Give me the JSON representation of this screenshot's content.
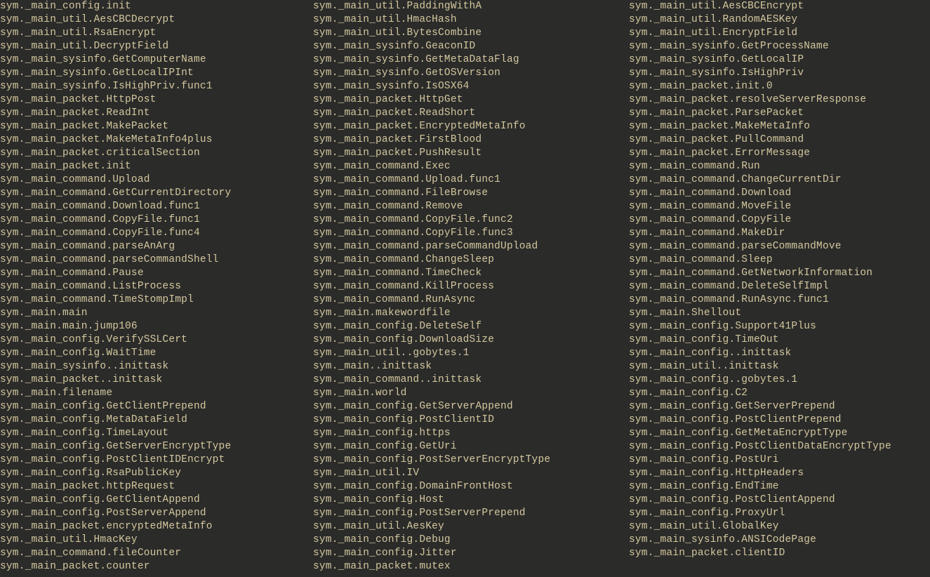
{
  "columns": [
    [
      "sym._main_config.init",
      "sym._main_util.AesCBCDecrypt",
      "sym._main_util.RsaEncrypt",
      "sym._main_util.DecryptField",
      "sym._main_sysinfo.GetComputerName",
      "sym._main_sysinfo.GetLocalIPInt",
      "sym._main_sysinfo.IsHighPriv.func1",
      "sym._main_packet.HttpPost",
      "sym._main_packet.ReadInt",
      "sym._main_packet.MakePacket",
      "sym._main_packet.MakeMetaInfo4plus",
      "sym._main_packet.criticalSection",
      "sym._main_packet.init",
      "sym._main_command.Upload",
      "sym._main_command.GetCurrentDirectory",
      "sym._main_command.Download.func1",
      "sym._main_command.CopyFile.func1",
      "sym._main_command.CopyFile.func4",
      "sym._main_command.parseAnArg",
      "sym._main_command.parseCommandShell",
      "sym._main_command.Pause",
      "sym._main_command.ListProcess",
      "sym._main_command.TimeStompImpl",
      "sym._main.main",
      "sym._main.main.jump106",
      "sym._main_config.VerifySSLCert",
      "sym._main_config.WaitTime",
      "sym._main_sysinfo..inittask",
      "sym._main_packet..inittask",
      "sym._main.filename",
      "sym._main_config.GetClientPrepend",
      "sym._main_config.MetaDataField",
      "sym._main_config.TimeLayout",
      "sym._main_config.GetServerEncryptType",
      "sym._main_config.PostClientIDEncrypt",
      "sym._main_config.RsaPublicKey",
      "sym._main_packet.httpRequest",
      "sym._main_config.GetClientAppend",
      "sym._main_config.PostServerAppend",
      "sym._main_packet.encryptedMetaInfo",
      "sym._main_util.HmacKey",
      "sym._main_command.fileCounter",
      "sym._main_packet.counter"
    ],
    [
      "sym._main_util.PaddingWithA",
      "sym._main_util.HmacHash",
      "sym._main_util.BytesCombine",
      "sym._main_sysinfo.GeaconID",
      "sym._main_sysinfo.GetMetaDataFlag",
      "sym._main_sysinfo.GetOSVersion",
      "sym._main_sysinfo.IsOSX64",
      "sym._main_packet.HttpGet",
      "sym._main_packet.ReadShort",
      "sym._main_packet.EncryptedMetaInfo",
      "sym._main_packet.FirstBlood",
      "sym._main_packet.PushResult",
      "sym._main_command.Exec",
      "sym._main_command.Upload.func1",
      "sym._main_command.FileBrowse",
      "sym._main_command.Remove",
      "sym._main_command.CopyFile.func2",
      "sym._main_command.CopyFile.func3",
      "sym._main_command.parseCommandUpload",
      "sym._main_command.ChangeSleep",
      "sym._main_command.TimeCheck",
      "sym._main_command.KillProcess",
      "sym._main_command.RunAsync",
      "sym._main.makewordfile",
      "sym._main_config.DeleteSelf",
      "sym._main_config.DownloadSize",
      "sym._main_util..gobytes.1",
      "sym._main..inittask",
      "sym._main_command..inittask",
      "sym._main.world",
      "sym._main_config.GetServerAppend",
      "sym._main_config.PostClientID",
      "sym._main_config.https",
      "sym._main_config.GetUri",
      "sym._main_config.PostServerEncryptType",
      "sym._main_util.IV",
      "sym._main_config.DomainFrontHost",
      "sym._main_config.Host",
      "sym._main_config.PostServerPrepend",
      "sym._main_util.AesKey",
      "sym._main_config.Debug",
      "sym._main_config.Jitter",
      "sym._main_packet.mutex"
    ],
    [
      "sym._main_util.AesCBCEncrypt",
      "sym._main_util.RandomAESKey",
      "sym._main_util.EncryptField",
      "sym._main_sysinfo.GetProcessName",
      "sym._main_sysinfo.GetLocalIP",
      "sym._main_sysinfo.IsHighPriv",
      "sym._main_packet.init.0",
      "sym._main_packet.resolveServerResponse",
      "sym._main_packet.ParsePacket",
      "sym._main_packet.MakeMetaInfo",
      "sym._main_packet.PullCommand",
      "sym._main_packet.ErrorMessage",
      "sym._main_command.Run",
      "sym._main_command.ChangeCurrentDir",
      "sym._main_command.Download",
      "sym._main_command.MoveFile",
      "sym._main_command.CopyFile",
      "sym._main_command.MakeDir",
      "sym._main_command.parseCommandMove",
      "sym._main_command.Sleep",
      "sym._main_command.GetNetworkInformation",
      "sym._main_command.DeleteSelfImpl",
      "sym._main_command.RunAsync.func1",
      "sym._main.Shellout",
      "sym._main_config.Support41Plus",
      "sym._main_config.TimeOut",
      "sym._main_config..inittask",
      "sym._main_util..inittask",
      "sym._main_config..gobytes.1",
      "sym._main_config.C2",
      "sym._main_config.GetServerPrepend",
      "sym._main_config.PostClientPrepend",
      "sym._main_config.GetMetaEncryptType",
      "sym._main_config.PostClientDataEncryptType",
      "sym._main_config.PostUri",
      "sym._main_config.HttpHeaders",
      "sym._main_config.EndTime",
      "sym._main_config.PostClientAppend",
      "sym._main_config.ProxyUrl",
      "sym._main_util.GlobalKey",
      "sym._main_sysinfo.ANSICodePage",
      "sym._main_packet.clientID"
    ]
  ]
}
